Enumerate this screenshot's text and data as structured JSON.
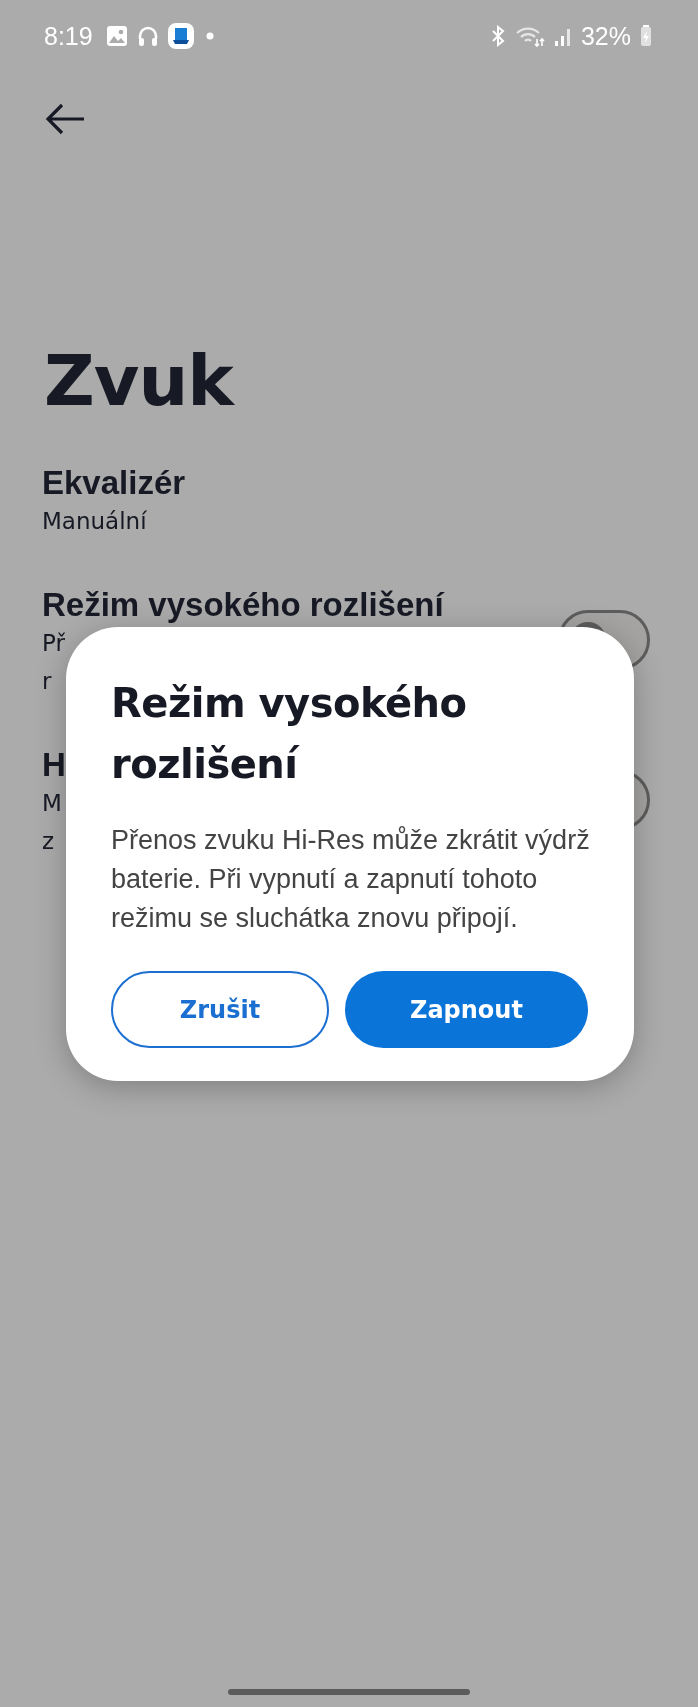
{
  "status_bar": {
    "time": "8:19",
    "battery": "32%"
  },
  "title": "Zvuk",
  "settings": [
    {
      "kind": "value",
      "title": "Ekvalizér",
      "subtitle_lines": [
        "Manuální"
      ]
    },
    {
      "kind": "switch",
      "title": "Režim vysokého rozlišení",
      "subtitle_lines": [
        "Př",
        "r"
      ],
      "on": false
    },
    {
      "kind": "switch",
      "title": "H",
      "subtitle_lines": [
        "M",
        "z"
      ],
      "on": false
    }
  ],
  "dialog": {
    "title": "Režim vysokého rozlišení",
    "message": "Přenos zvuku Hi-Res může zkrátit výdrž baterie. Při vypnutí a zapnutí tohoto režimu se sluchátka znovu připojí.",
    "buttons": [
      {
        "label": "Zrušit",
        "kind": "outline"
      },
      {
        "label": "Zapnout",
        "kind": "filled"
      }
    ]
  }
}
